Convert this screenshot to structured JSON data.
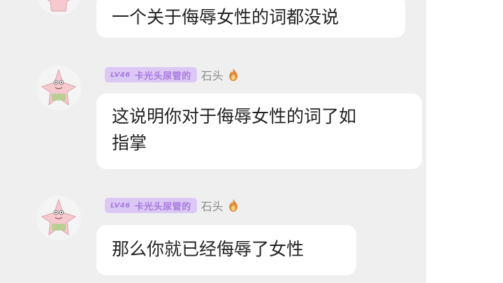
{
  "colors": {
    "background": "#efefef",
    "bubble": "#ffffff",
    "badge_bg": "#dcc8f4",
    "badge_text": "#a77ae0",
    "username": "#8b8b8b"
  },
  "messages": [
    {
      "text": "一个关于侮辱女性的词都没说",
      "has_header": false
    },
    {
      "level": "LV46",
      "badge_title": "卡光头尿管的",
      "username": "石头",
      "user_icon": "flame-icon",
      "text_lines": [
        "这说明你对于侮辱女性的词了如",
        "指掌"
      ]
    },
    {
      "level": "LV46",
      "badge_title": "卡光头尿管的",
      "username": "石头",
      "user_icon": "flame-icon",
      "text": "那么你就已经侮辱了女性"
    }
  ]
}
